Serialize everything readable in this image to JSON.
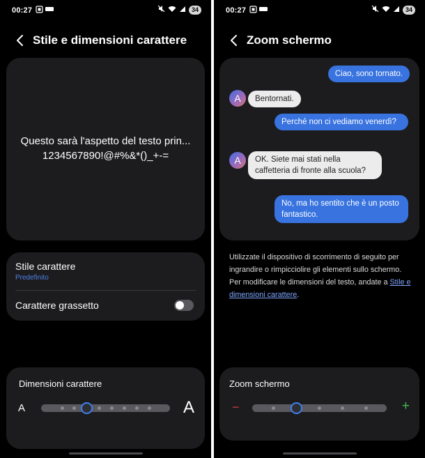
{
  "left": {
    "status": {
      "time": "00:27",
      "battery": "34"
    },
    "title": "Stile e dimensioni carattere",
    "preview": {
      "line1": "Questo sarà l'aspetto del testo prin...",
      "line2": "1234567890!@#%&*()_+-="
    },
    "font_style": {
      "label": "Stile carattere",
      "value": "Predefinito"
    },
    "bold_font": {
      "label": "Carattere grassetto",
      "enabled": false
    },
    "font_size": {
      "title": "Dimensioni carattere",
      "small_label": "A",
      "large_label": "A",
      "steps": 8,
      "level": 2
    }
  },
  "right": {
    "status": {
      "time": "00:27",
      "battery": "34"
    },
    "title": "Zoom schermo",
    "chat": {
      "msg1": "Ciao, sono tornato.",
      "msg2": "Bentornati.",
      "msg3": "Perché non ci vediamo venerdì?",
      "msg4": "OK. Siete mai stati nella caffetteria di fronte alla scuola?",
      "msg5": "No, ma ho sentito che è un posto fantastico.",
      "avatar": "A"
    },
    "info_text": "Utilizzate il dispositivo di scorrimento di seguito per ingrandire o rimpicciolire gli elementi sullo schermo. Per modificare le dimensioni del testo, andate a",
    "info_link": "Stile e dimensioni carattere",
    "info_end": ".",
    "zoom": {
      "title": "Zoom schermo",
      "minus": "−",
      "plus": "+",
      "steps": 5,
      "level": 1
    }
  },
  "colors": {
    "accent": "#3f7ff0",
    "link": "#4e80e8",
    "minus": "#d23a3a",
    "plus": "#3fbe4b"
  },
  "icons": [
    "back-arrow-icon",
    "mute-icon",
    "wifi-icon",
    "signal-icon",
    "battery-icon",
    "minus-icon",
    "plus-icon"
  ]
}
